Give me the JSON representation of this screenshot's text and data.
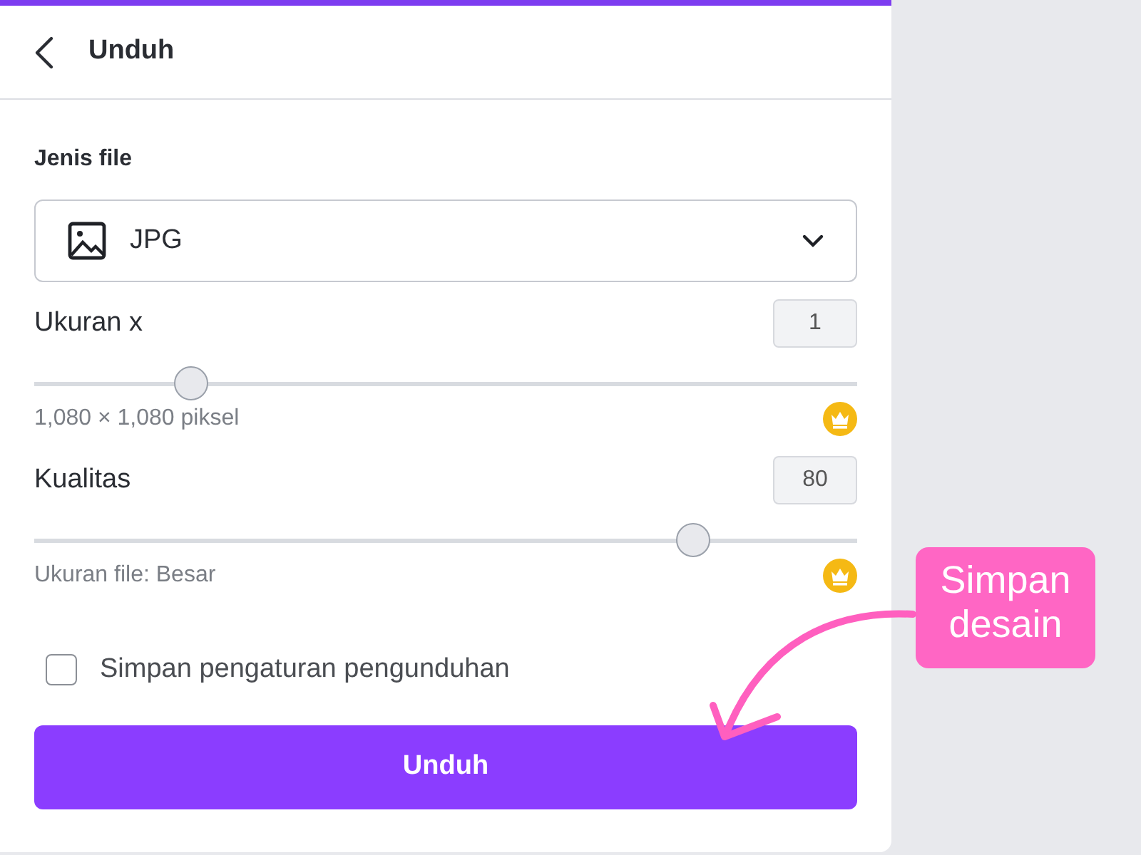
{
  "header": {
    "title": "Unduh"
  },
  "file_type": {
    "label": "Jenis file",
    "value": "JPG"
  },
  "sliders": [
    {
      "label": "Ukuran x",
      "value": "1",
      "level": 0.19,
      "caption": "1,080 × 1,080 piksel",
      "premium": true
    },
    {
      "label": "Kualitas",
      "value": "80",
      "level": 0.8,
      "caption": "Ukuran file: Besar",
      "premium": true
    }
  ],
  "save_settings": {
    "label": "Simpan pengaturan pengunduhan",
    "checked": false
  },
  "download_button": "Unduh",
  "callout": "Simpan desain"
}
